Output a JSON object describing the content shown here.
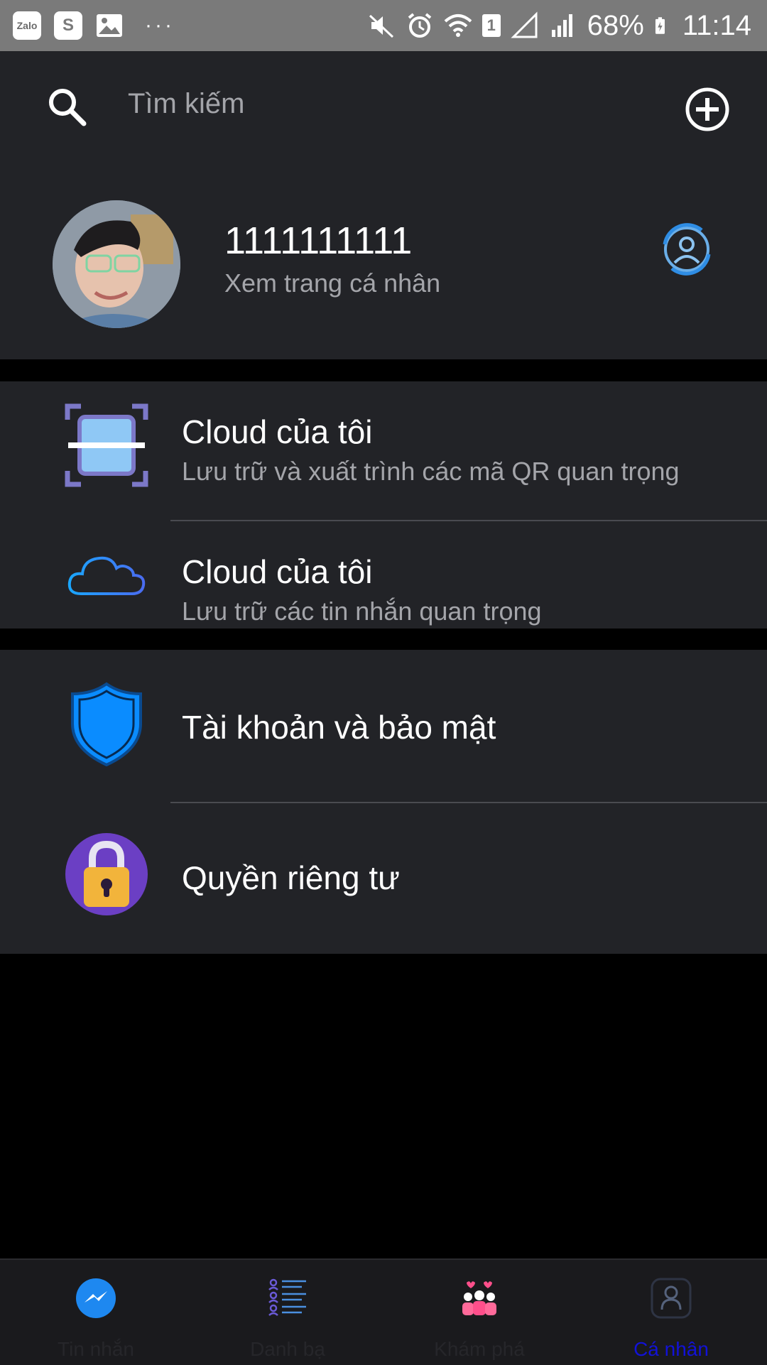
{
  "status_bar": {
    "left_icons": [
      "zalo-icon",
      "shopee-icon",
      "gallery-icon"
    ],
    "zalo_label": "Zalo",
    "shopee_label": "S",
    "more": "···",
    "sim": "1",
    "battery": "68%",
    "time": "11:14"
  },
  "header": {
    "search_placeholder": "Tìm kiếm"
  },
  "profile": {
    "name": "1111111111",
    "subtitle": "Xem trang cá nhân"
  },
  "menu": {
    "qr": {
      "title": "Cloud của tôi",
      "subtitle": "Lưu trữ và xuất trình các mã QR quan trọng"
    },
    "cloud": {
      "title": "Cloud của tôi",
      "subtitle": "Lưu trữ các tin nhắn quan trọng"
    },
    "security": {
      "title": "Tài khoản và bảo mật"
    },
    "privacy": {
      "title": "Quyền riêng tư"
    }
  },
  "bottom_nav": {
    "items": [
      {
        "label": "Tin nhắn",
        "icon": "messenger-icon",
        "active": false
      },
      {
        "label": "Danh bạ",
        "icon": "contacts-icon",
        "active": false
      },
      {
        "label": "Khám phá",
        "icon": "discover-icon",
        "active": false
      },
      {
        "label": "Cá nhân",
        "icon": "profile-icon",
        "active": true
      }
    ]
  },
  "colors": {
    "background": "#000000",
    "surface": "#222327",
    "text_secondary": "#a4a5aa",
    "active_nav": "#1212d8",
    "accent_blue": "#0a8cff"
  }
}
